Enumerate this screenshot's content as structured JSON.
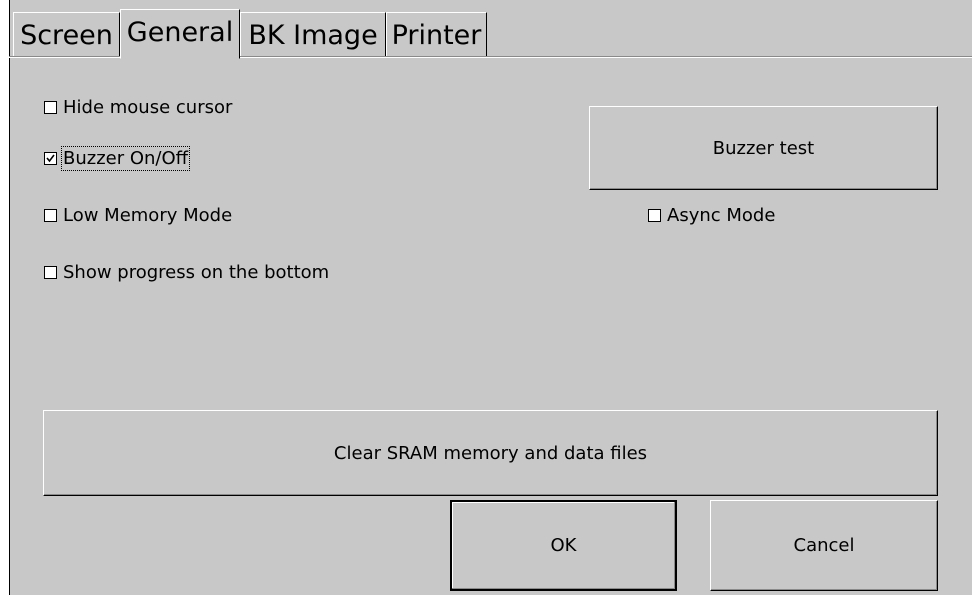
{
  "tabs": [
    {
      "label": "Screen",
      "active": false
    },
    {
      "label": "General",
      "active": true
    },
    {
      "label": "BK Image",
      "active": false
    },
    {
      "label": "Printer",
      "active": false
    }
  ],
  "options": {
    "hide_mouse_cursor": {
      "label": "Hide mouse cursor",
      "checked": false
    },
    "buzzer_onoff": {
      "label": "Buzzer On/Off",
      "checked": true
    },
    "low_memory_mode": {
      "label": "Low Memory Mode",
      "checked": false
    },
    "async_mode": {
      "label": "Async Mode",
      "checked": false
    },
    "show_progress": {
      "label": "Show progress on the bottom",
      "checked": false
    }
  },
  "buttons": {
    "buzzer_test": "Buzzer test",
    "clear_sram": "Clear SRAM memory and data files",
    "ok": "OK",
    "cancel": "Cancel"
  }
}
